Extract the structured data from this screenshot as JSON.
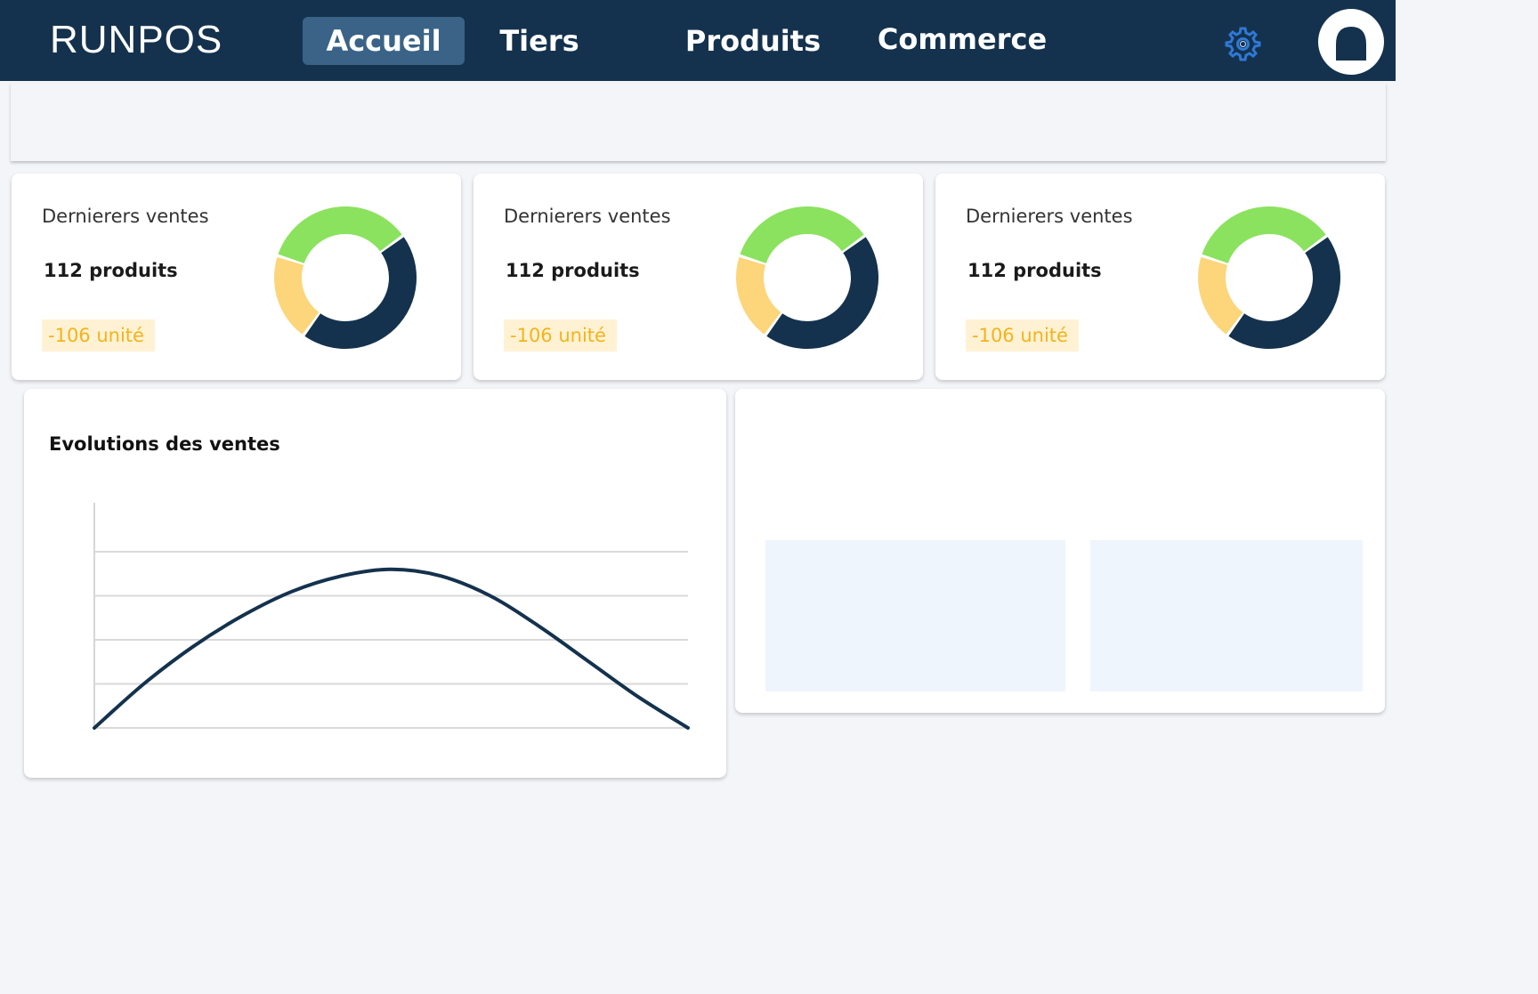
{
  "app": {
    "brand": "RUNPOS"
  },
  "nav": {
    "items": [
      {
        "label": "Accueil",
        "active": true
      },
      {
        "label": "Tiers",
        "active": false
      },
      {
        "label": "Produits",
        "active": false
      },
      {
        "label": "Commerce",
        "active": false
      }
    ],
    "settings_icon": "gear-icon",
    "avatar_icon": "user-avatar-icon"
  },
  "stats": [
    {
      "title": "Dernierers ventes",
      "value": "112 produits",
      "delta": "-106 unité",
      "donut": [
        {
          "value": 35,
          "color": "#8be25e"
        },
        {
          "value": 45,
          "color": "#14324d"
        },
        {
          "value": 20,
          "color": "#fdd57a"
        }
      ]
    },
    {
      "title": "Dernierers ventes",
      "value": "112 produits",
      "delta": "-106 unité",
      "donut": [
        {
          "value": 35,
          "color": "#8be25e"
        },
        {
          "value": 45,
          "color": "#14324d"
        },
        {
          "value": 20,
          "color": "#fdd57a"
        }
      ]
    },
    {
      "title": "Dernierers ventes",
      "value": "112 produits",
      "delta": "-106 unité",
      "donut": [
        {
          "value": 35,
          "color": "#8be25e"
        },
        {
          "value": 45,
          "color": "#14324d"
        },
        {
          "value": 20,
          "color": "#fdd57a"
        }
      ]
    }
  ],
  "colors": {
    "navbar": "#14324d",
    "nav_active": "#3a6387",
    "delta_text": "#f4b31a",
    "delta_bg": "#fff2d4",
    "line": "#14324d"
  },
  "chart_data": {
    "type": "line",
    "title": "Evolutions des ventes",
    "xlabel": "",
    "ylabel": "",
    "grid": true,
    "x": [
      0,
      1,
      2,
      3,
      4,
      5,
      6,
      7,
      8,
      9,
      10,
      11,
      12
    ],
    "series": [
      {
        "values": [
          0,
          1.0,
          1.85,
          2.55,
          3.1,
          3.45,
          3.6,
          3.45,
          3.0,
          2.3,
          1.5,
          0.7,
          0
        ]
      }
    ],
    "ylim": [
      0,
      4
    ]
  }
}
